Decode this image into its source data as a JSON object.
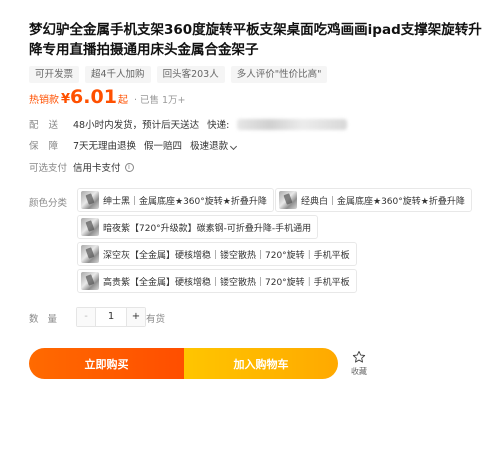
{
  "product": {
    "title": "梦幻驴全金属手机支架360度旋转平板支架桌面吃鸡画画ipad支撑架旋转升降专用直播拍摄通用床头金属合金架子",
    "tags": [
      "可开发票",
      "超4千人加购",
      "回头客203人",
      "多人评价\"性价比高\""
    ]
  },
  "price": {
    "label": "热销款",
    "currency": "¥",
    "value": "6.01",
    "suffix": "起",
    "sold": "· 已售 1万+"
  },
  "shipping": {
    "label": "配送",
    "text": "48小时内发货，预计后天送达",
    "express_label": "快递:"
  },
  "guarantee": {
    "label": "保障",
    "items": [
      "7天无理由退换",
      "假一赔四",
      "极速退款"
    ]
  },
  "payment": {
    "label": "可选支付",
    "text": "信用卡支付"
  },
  "color": {
    "label": "颜色分类",
    "options": [
      "绅士黑｜金属底座★360°旋转★折叠升降",
      "经典白｜金属底座★360°旋转★折叠升降",
      "暗夜紫【720°升级款】碳素钢-可折叠升降-手机通用",
      "深空灰【全金属】硬核增稳｜镂空散热｜720°旋转｜手机平板",
      "高贵紫【全金属】硬核增稳｜镂空散热｜720°旋转｜手机平板"
    ]
  },
  "quantity": {
    "label": "数量",
    "minus": "-",
    "value": "1",
    "plus": "+",
    "stock": "有货"
  },
  "actions": {
    "buy_now": "立即购买",
    "add_to_cart": "加入购物车",
    "favorite": "收藏"
  }
}
